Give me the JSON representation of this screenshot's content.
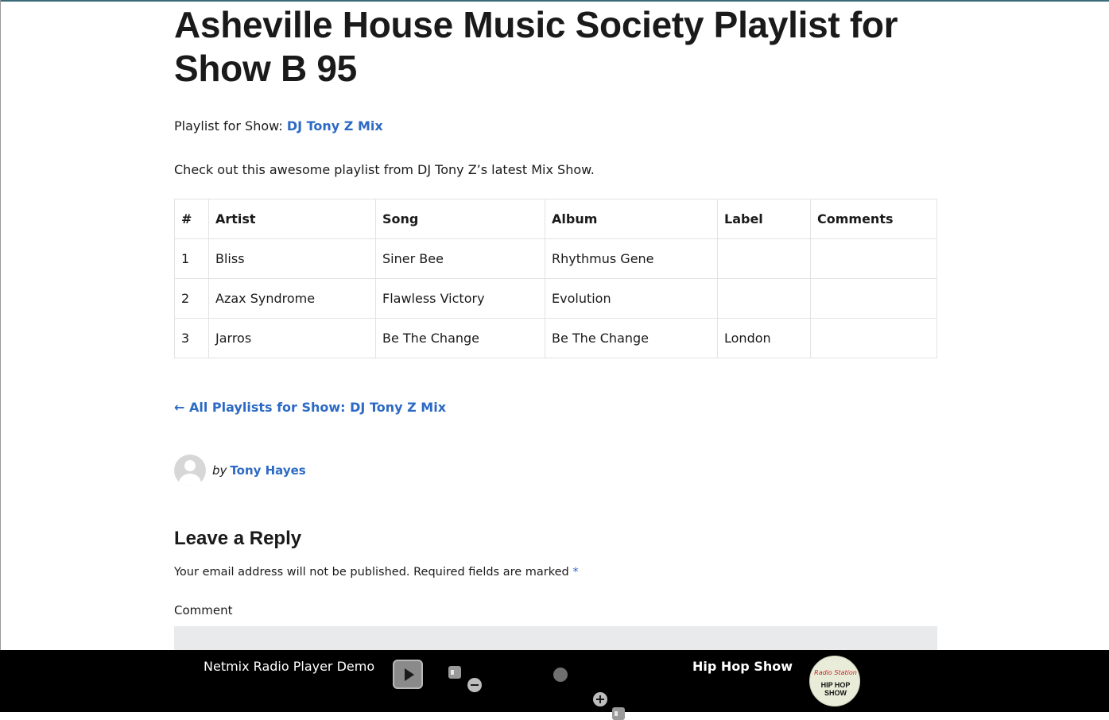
{
  "post": {
    "title": "Asheville House Music Society Playlist for Show B 95",
    "show_prefix": "Playlist for Show: ",
    "show_link": "DJ Tony Z Mix",
    "description": "Check out this awesome playlist from DJ Tony Z’s latest Mix Show."
  },
  "playlist": {
    "headers": [
      "#",
      "Artist",
      "Song",
      "Album",
      "Label",
      "Comments"
    ],
    "rows": [
      [
        "1",
        "Bliss",
        "Siner Bee",
        "Rhythmus Gene",
        "",
        ""
      ],
      [
        "2",
        "Azax Syndrome",
        "Flawless Victory",
        "Evolution",
        "",
        ""
      ],
      [
        "3",
        "Jarros",
        "Be The Change",
        "Be The Change",
        "London",
        ""
      ]
    ]
  },
  "back_link": "← All Playlists for Show: DJ Tony Z Mix",
  "author": {
    "by": "by",
    "name": "Tony Hayes"
  },
  "reply": {
    "heading": "Leave a Reply",
    "notice": "Your email address will not be published. Required fields are marked ",
    "required_mark": "*",
    "comment_label": "Comment"
  },
  "player": {
    "title": "Netmix Radio Player Demo",
    "current_show": "Hip Hop Show",
    "logo_script": "Radio Station",
    "logo_name": "HIP HOP SHOW",
    "icons": [
      "play-icon",
      "mute-icon",
      "volume-down-icon",
      "volume-knob",
      "volume-up-icon",
      "max-volume-icon"
    ]
  },
  "colors": {
    "link": "#2c6ac4",
    "player_bg": "#000000",
    "comment_bg": "#e9eaec"
  }
}
